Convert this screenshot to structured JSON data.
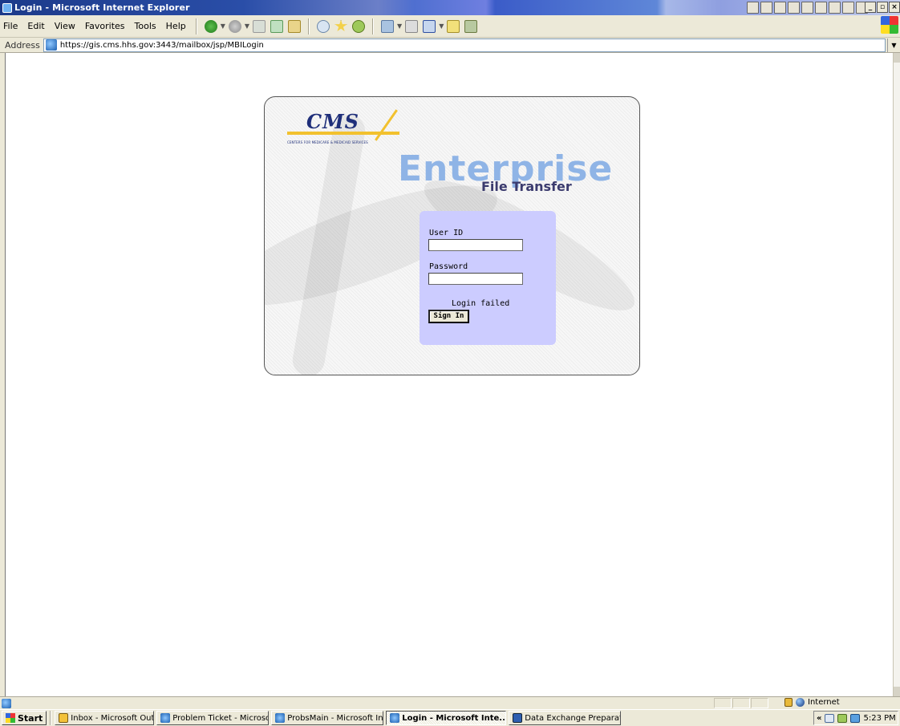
{
  "window": {
    "title": "Login - Microsoft Internet Explorer"
  },
  "menu": [
    "File",
    "Edit",
    "View",
    "Favorites",
    "Tools",
    "Help"
  ],
  "address": {
    "label": "Address",
    "url": "https://gis.cms.hhs.gov:3443/mailbox/jsp/MBILogin"
  },
  "page": {
    "logo_text": "CMS",
    "logo_subtitle": "Centers for Medicare & Medicaid Services",
    "product_title": "Enterprise",
    "product_subtitle": "File Transfer",
    "login": {
      "user_label": "User ID",
      "user_value": "",
      "password_label": "Password",
      "password_value": "",
      "message": "Login failed",
      "sign_in": "Sign In"
    }
  },
  "status": {
    "zone": "Internet"
  },
  "taskbar": {
    "start": "Start",
    "tasks": [
      {
        "label": "Inbox - Microsoft Outlook",
        "icon": "outlook-icon"
      },
      {
        "label": "Problem Ticket - Microsof...",
        "icon": "ie-icon"
      },
      {
        "label": "ProbsMain - Microsoft Int...",
        "icon": "ie-icon"
      },
      {
        "label": "Login - Microsoft Inte...",
        "icon": "ie-icon"
      },
      {
        "label": "Data Exchange Preparati...",
        "icon": "word-icon"
      }
    ],
    "clock": "5:23 PM"
  },
  "colors": {
    "title_gradient_start": "#1c3a8a",
    "login_panel": "#ccccff",
    "enterprise_blue": "#8fb4e6",
    "cms_navy": "#1f2f7a",
    "cms_gold": "#f2c12e"
  }
}
